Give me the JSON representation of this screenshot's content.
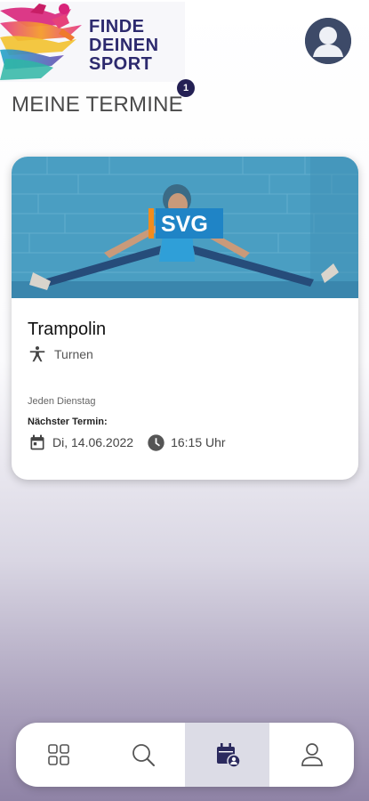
{
  "brand": {
    "logo_lines": [
      "FINDE",
      "DEINEN",
      "SPORT"
    ],
    "primary_color": "#2d2a6e"
  },
  "header": {
    "avatar_icon": "user-avatar-icon"
  },
  "section": {
    "title": "MEINE TERMINE",
    "badge_count": "1"
  },
  "appointment": {
    "image_logo_text": "SVG",
    "course_title": "Trampolin",
    "sport_icon": "gymnastics-icon",
    "sport": "Turnen",
    "recurrence": "Jeden Dienstag",
    "next_label": "Nächster Termin:",
    "date": "Di, 14.06.2022",
    "time": "16:15 Uhr"
  },
  "bottom_nav": {
    "items": [
      {
        "name": "overview",
        "icon": "grid-icon",
        "active": false
      },
      {
        "name": "search",
        "icon": "search-icon",
        "active": false
      },
      {
        "name": "appointments",
        "icon": "calendar-user-icon",
        "active": true
      },
      {
        "name": "profile",
        "icon": "person-icon",
        "active": false
      }
    ]
  }
}
